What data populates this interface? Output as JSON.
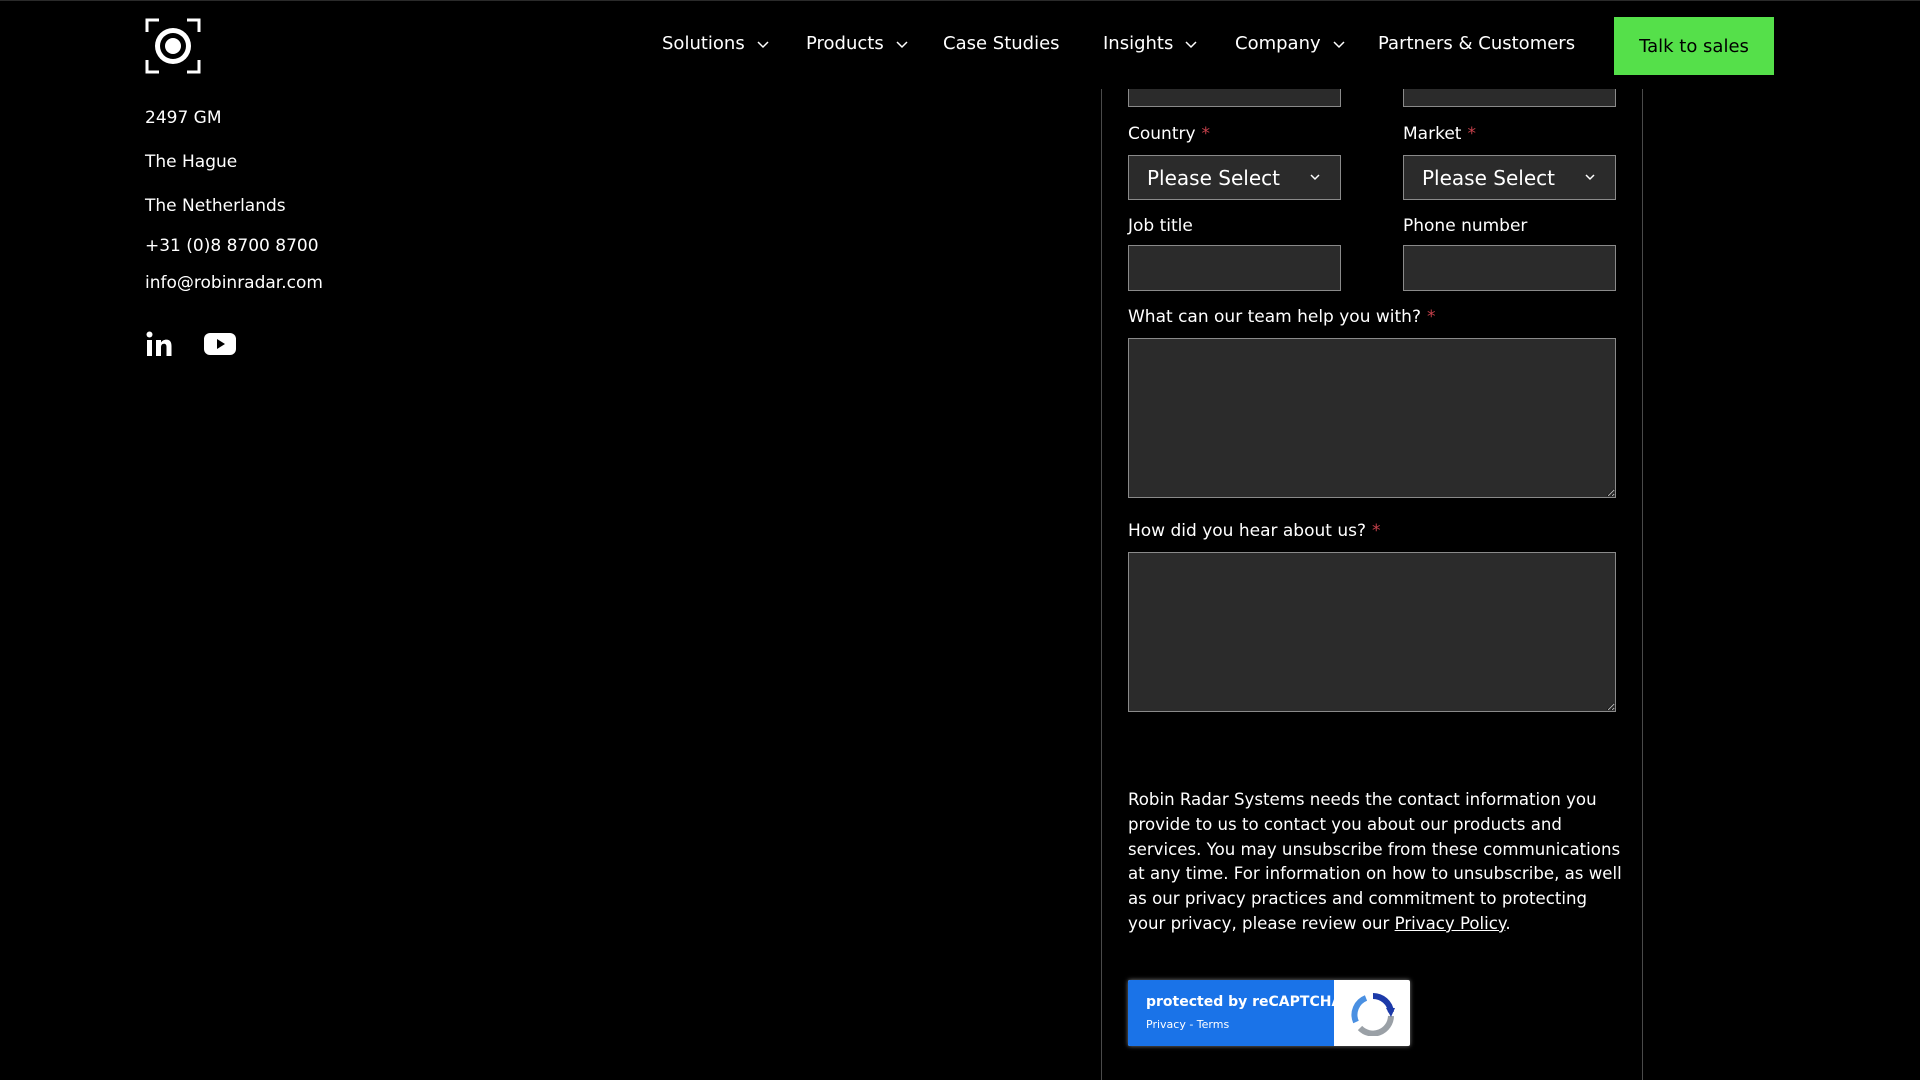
{
  "nav": {
    "items": [
      {
        "label": "Solutions",
        "dropdown": true
      },
      {
        "label": "Products",
        "dropdown": true
      },
      {
        "label": "Case Studies",
        "dropdown": false
      },
      {
        "label": "Insights",
        "dropdown": true
      },
      {
        "label": "Company",
        "dropdown": true
      },
      {
        "label": "Partners & Customers",
        "dropdown": false
      }
    ],
    "cta_label": "Talk to sales"
  },
  "contact": {
    "postal_code": "2497 GM",
    "city": "The Hague",
    "country": "The Netherlands",
    "phone": "+31 (0)8 8700 8700",
    "email": "info@robinradar.com",
    "social_icons": [
      "linkedin-icon",
      "youtube-icon"
    ]
  },
  "form": {
    "required_marker": "*",
    "country_label": "Country",
    "country_value": "Please Select",
    "market_label": "Market",
    "market_value": "Please Select",
    "job_title_label": "Job title",
    "phone_label": "Phone number",
    "help_label": "What can our team help you with?",
    "hear_label": "How did you hear about us?",
    "consent_text": "Robin Radar Systems needs the contact information you provide to us to contact you about our products and services. You may unsubscribe from these communications at any time. For information on how to unsubscribe, as well as our privacy practices and commitment to protecting your privacy, please review our ",
    "privacy_link": "Privacy Policy",
    "consent_end": "."
  },
  "recaptcha": {
    "title": "protected by reCAPTCHA",
    "links": "Privacy - Terms"
  },
  "colors": {
    "background": "#000000",
    "cta": "#55e04a",
    "field_bg": "#2b2b2b",
    "required": "#c6414b",
    "recaptcha_blue": "#1a73e8"
  }
}
